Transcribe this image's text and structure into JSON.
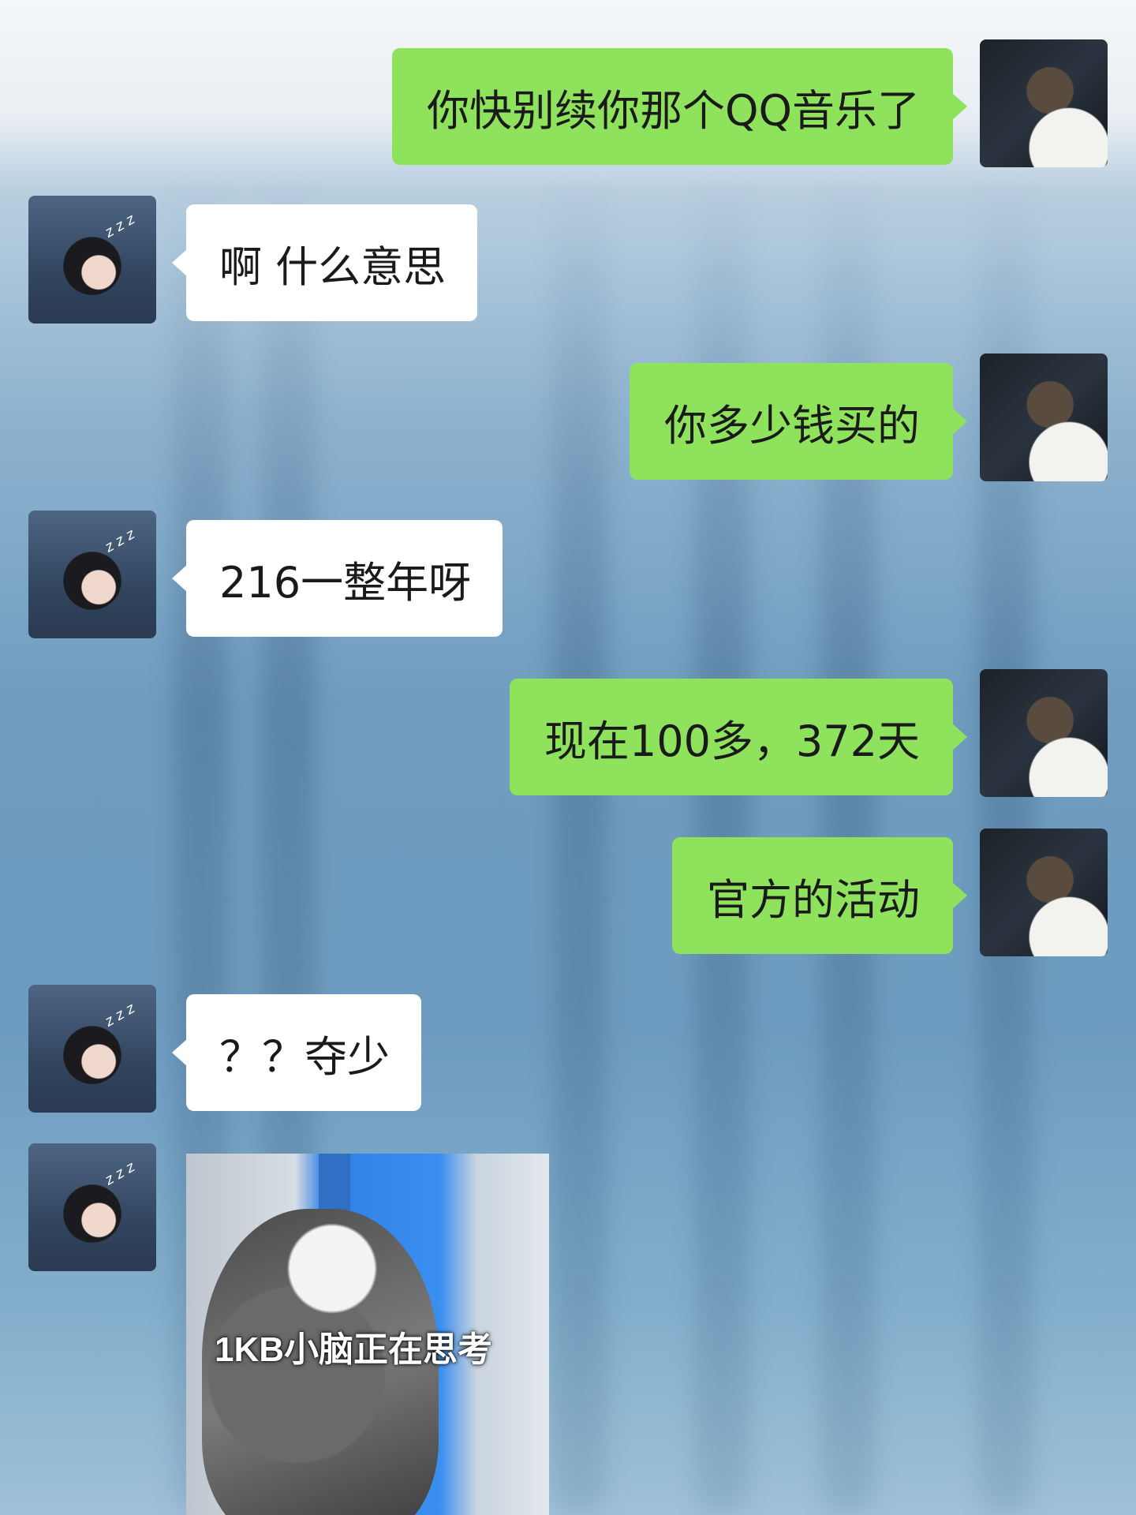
{
  "chat": {
    "messages": [
      {
        "sender": "me",
        "text": "你快别续你那个QQ音乐了"
      },
      {
        "sender": "her",
        "text": "啊 什么意思"
      },
      {
        "sender": "me",
        "text": "你多少钱买的"
      },
      {
        "sender": "her",
        "text": "216一整年呀"
      },
      {
        "sender": "me",
        "text": "现在100多，372天"
      },
      {
        "sender": "me",
        "text": "官方的活动"
      },
      {
        "sender": "her",
        "text": "？？夺少"
      }
    ],
    "sticker": {
      "caption": "1KB小脑正在思考"
    },
    "her_avatar_mark": "z z z"
  },
  "colors": {
    "sent_bubble": "#8fe35c",
    "received_bubble": "#ffffff"
  }
}
